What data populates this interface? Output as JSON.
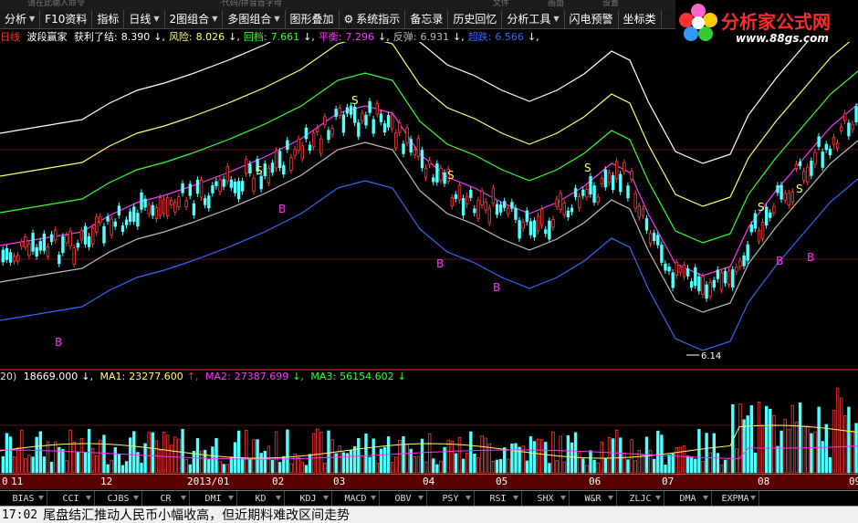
{
  "top_strip": {
    "left_text": "请在此输入命令",
    "mid_text": "·代码/拼音首字母",
    "right_items": [
      "文件",
      "画面",
      "设置"
    ]
  },
  "toolbar": [
    {
      "label": "分析",
      "arrow": true
    },
    {
      "label": "F10资料",
      "arrow": false
    },
    {
      "label": "指标",
      "arrow": false
    },
    {
      "label": "日线",
      "arrow": true
    },
    {
      "label": "2图组合",
      "arrow": true
    },
    {
      "label": "多图组合",
      "arrow": true
    },
    {
      "label": "图形叠加",
      "arrow": false
    },
    {
      "label": "系统指示",
      "arrow": false
    },
    {
      "label": "备忘录",
      "arrow": false
    },
    {
      "label": "历史回忆",
      "arrow": false
    },
    {
      "label": "分析工具",
      "arrow": true
    },
    {
      "label": "闪电预警",
      "arrow": false
    },
    {
      "label": "坐标类",
      "arrow": false
    }
  ],
  "logo": {
    "text": "分析家公式网",
    "url": "www.88gs.com"
  },
  "indicator": {
    "period": "日线",
    "name": "波段赢家",
    "items": [
      {
        "label": "获利了结:",
        "value": "8.390",
        "color": "#ffffff"
      },
      {
        "label": "风险:",
        "value": "8.026",
        "color": "#ffff66"
      },
      {
        "label": "回档:",
        "value": "7.661",
        "color": "#33ff33"
      },
      {
        "label": "平衡:",
        "value": "7.296",
        "color": "#ff33ff"
      },
      {
        "label": "反弹:",
        "value": "6.931",
        "color": "#bbbbbb"
      },
      {
        "label": "超跌:",
        "value": "6.566",
        "color": "#3366ff"
      }
    ],
    "low_marker": "6.14",
    "signal_s": "S",
    "signal_b": "B"
  },
  "volume": {
    "prefix": "20)",
    "vol": "18669.000",
    "ma1_label": "MA1:",
    "ma1": "23277.600",
    "ma2_label": "MA2:",
    "ma2": "27387.699",
    "ma3_label": "MA3:",
    "ma3": "56154.602"
  },
  "date_axis": [
    "0",
    "11",
    "12",
    "2013/01",
    "02",
    "03",
    "04",
    "05",
    "06",
    "07",
    "08",
    "09"
  ],
  "tabs": [
    "BIAS",
    "CCI",
    "CJBS",
    "CR",
    "DMI",
    "KD",
    "KDJ",
    "MACD",
    "OBV",
    "PSY",
    "RSI",
    "SHX",
    "W&R",
    "ZLJC",
    "DMA",
    "EXPMA"
  ],
  "status": {
    "time": "17:02",
    "news": "尾盘结汇推动人民币小幅收高，但近期料难改区间走势"
  },
  "colors": {
    "up": "#ff3b3b",
    "down": "#54ffff",
    "band_top": "#ffffff",
    "band_risk": "#ffff66",
    "band_pullback": "#33ff33",
    "band_balance": "#ff33ff",
    "band_rebound": "#bbbbbb",
    "band_oversold": "#3366ff"
  }
}
